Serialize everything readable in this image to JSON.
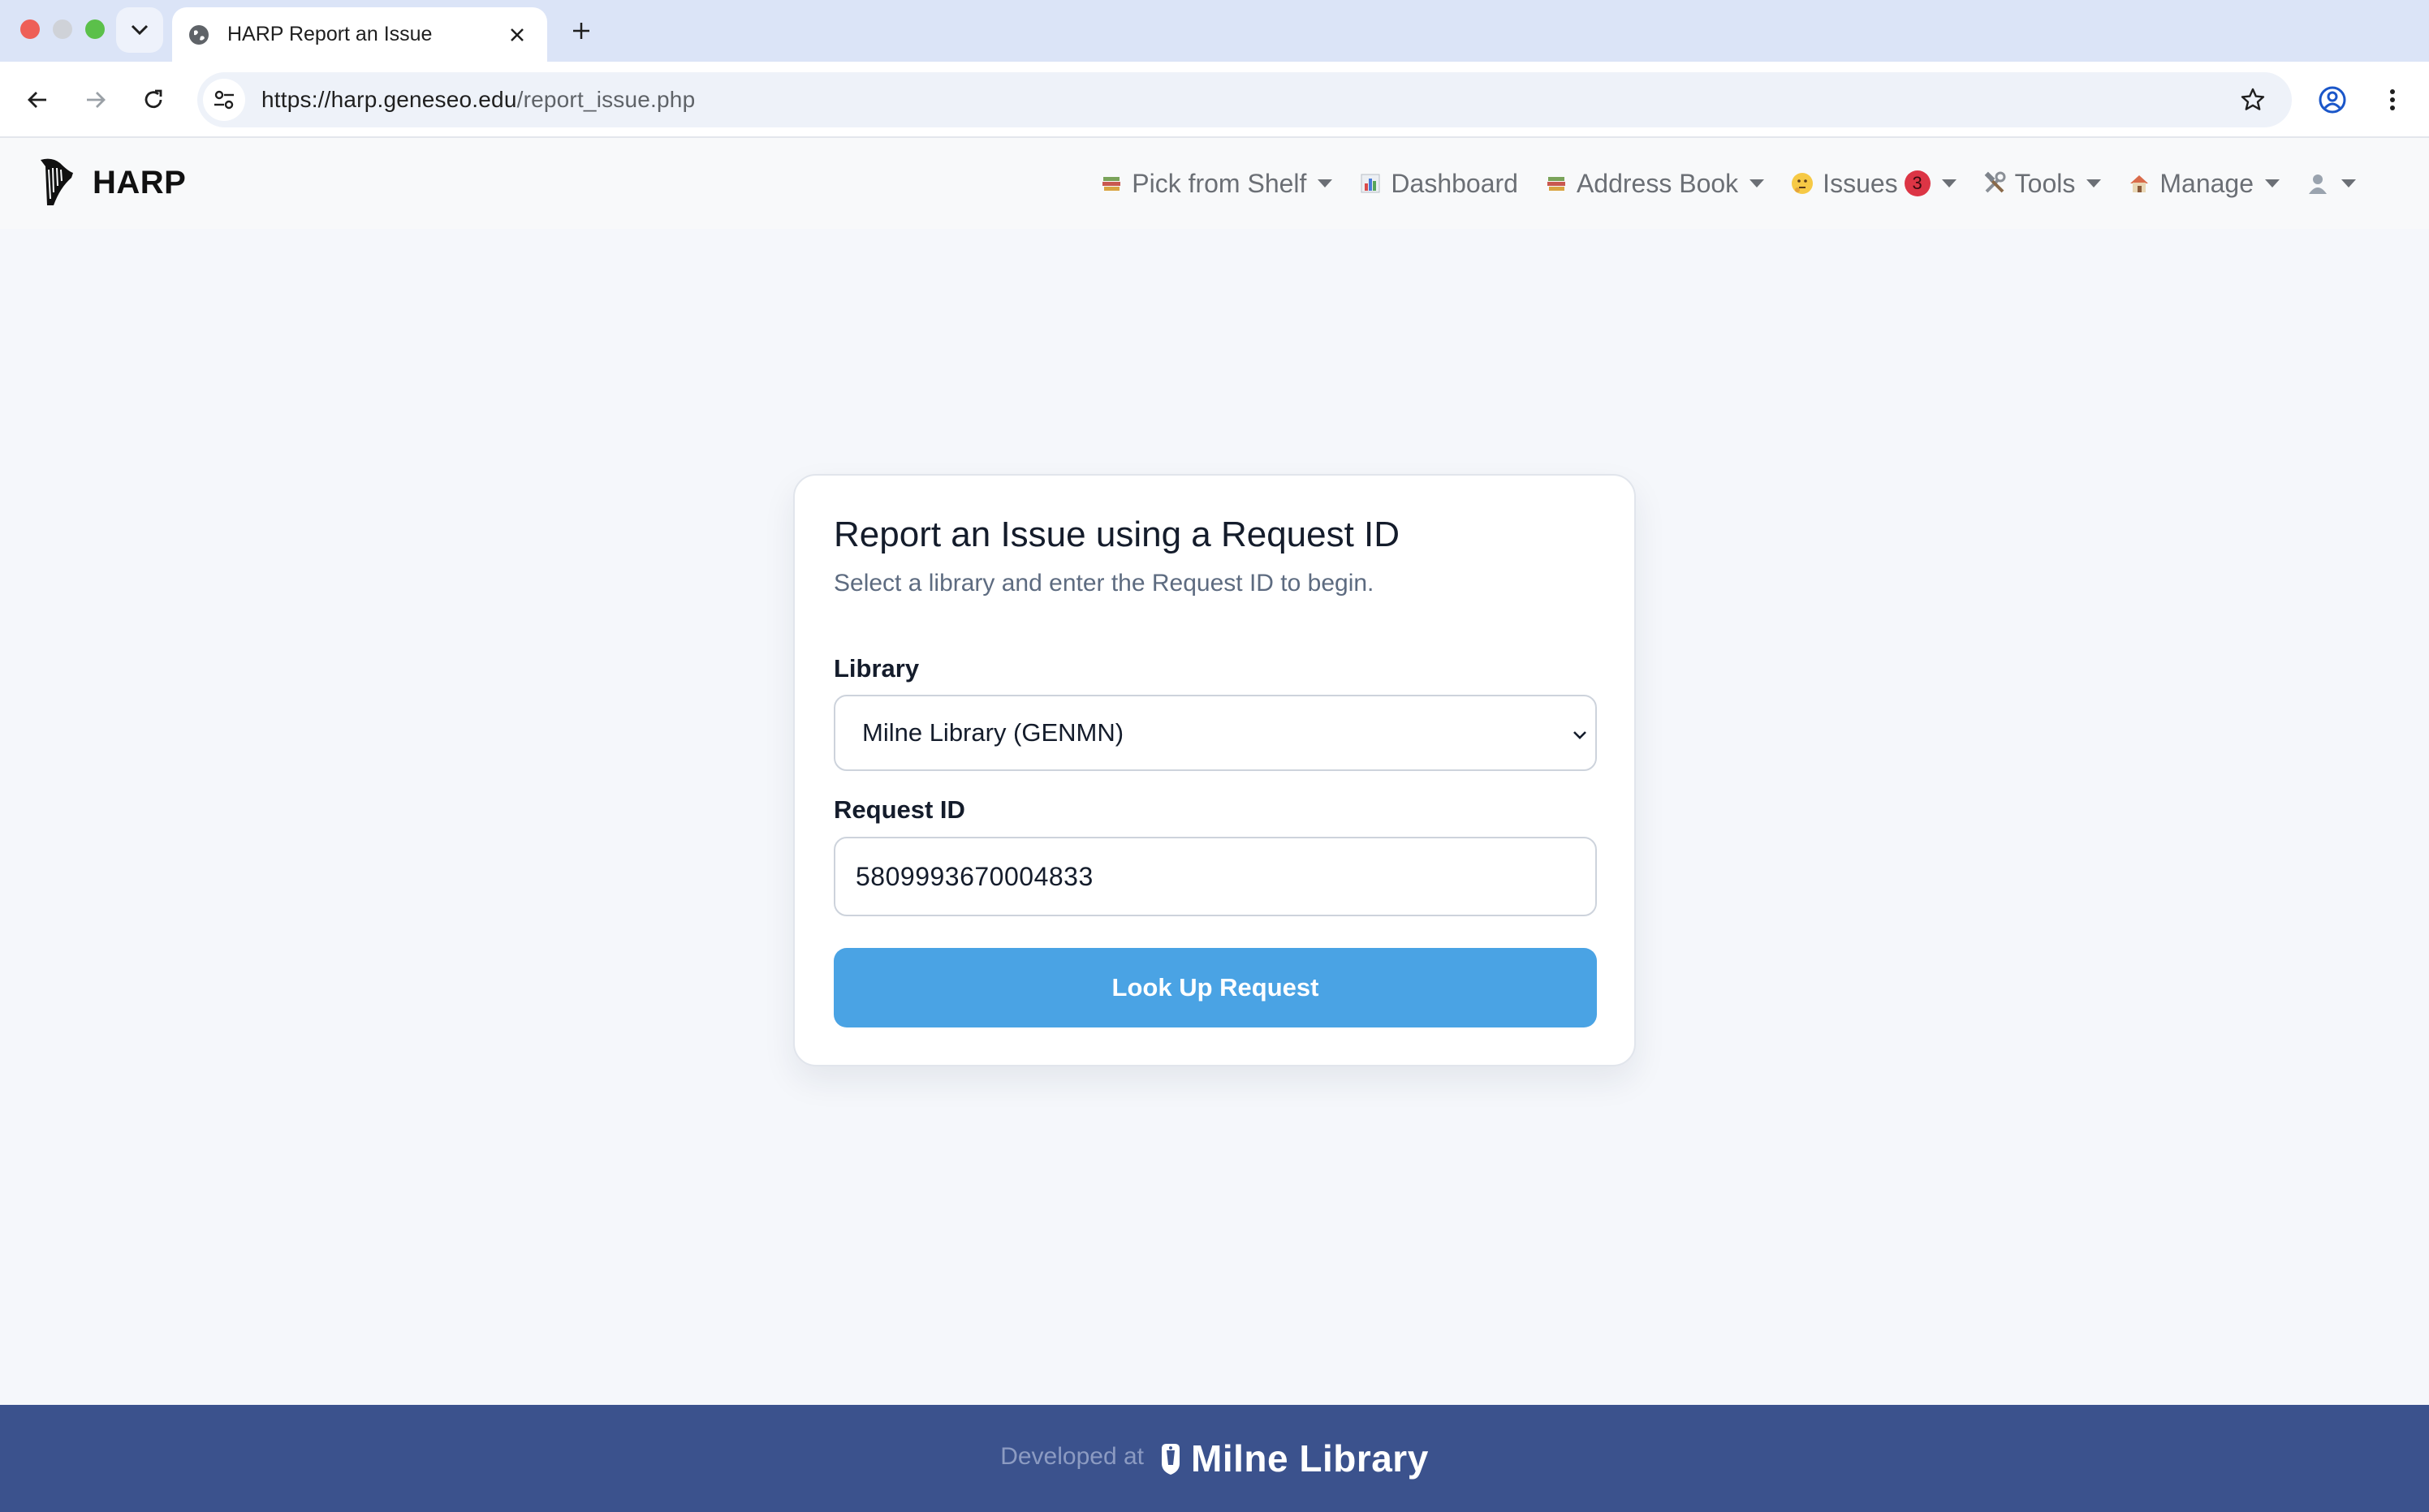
{
  "browser": {
    "tab_title": "HARP Report an Issue",
    "url_host": "https://harp.geneseo.edu",
    "url_path": "/report_issue.php"
  },
  "app": {
    "brand": "HARP",
    "nav": [
      {
        "label": "Pick from Shelf",
        "icon": "books-icon"
      },
      {
        "label": "Dashboard",
        "icon": "bar-chart-icon"
      },
      {
        "label": "Address Book",
        "icon": "books-icon"
      },
      {
        "label": "Issues",
        "icon": "thinking-face-icon",
        "badge": "3"
      },
      {
        "label": "Tools",
        "icon": "hammer-wrench-icon"
      },
      {
        "label": "Manage",
        "icon": "house-icon"
      },
      {
        "label": "",
        "icon": "user-icon"
      }
    ]
  },
  "card": {
    "title": "Report an Issue using a Request ID",
    "subtitle": "Select a library and enter the Request ID to begin.",
    "library_label": "Library",
    "library_value": "Milne Library (GENMN)",
    "request_label": "Request ID",
    "request_value": "5809993670004833",
    "button_label": "Look Up Request"
  },
  "footer": {
    "developed_at": "Developed at",
    "logo_text": "Milne Library"
  },
  "colors": {
    "accent": "#4aa3e4",
    "footer": "#3b528d",
    "badge": "#dc3545"
  }
}
